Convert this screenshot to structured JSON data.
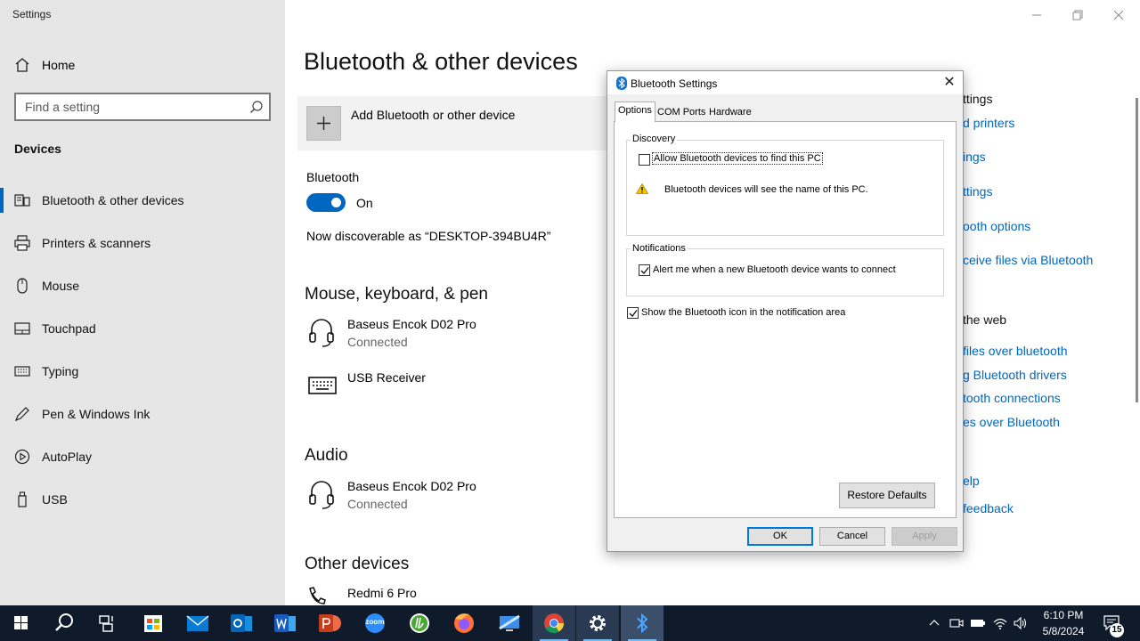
{
  "window": {
    "title": "Settings"
  },
  "sidebar": {
    "home_label": "Home",
    "search_placeholder": "Find a setting",
    "section_label": "Devices",
    "items": [
      {
        "label": "Bluetooth & other devices",
        "icon": "bluetooth-devices-icon",
        "selected": true
      },
      {
        "label": "Printers & scanners",
        "icon": "printer-icon"
      },
      {
        "label": "Mouse",
        "icon": "mouse-icon"
      },
      {
        "label": "Touchpad",
        "icon": "touchpad-icon"
      },
      {
        "label": "Typing",
        "icon": "keyboard-icon"
      },
      {
        "label": "Pen & Windows Ink",
        "icon": "pen-icon"
      },
      {
        "label": "AutoPlay",
        "icon": "autoplay-icon"
      },
      {
        "label": "USB",
        "icon": "usb-icon"
      }
    ]
  },
  "main": {
    "title": "Bluetooth & other devices",
    "add_device_label": "Add Bluetooth or other device",
    "bluetooth_label": "Bluetooth",
    "toggle_state": "On",
    "discoverable_text": "Now discoverable as “DESKTOP-394BU4R”",
    "sections": [
      {
        "heading": "Mouse, keyboard, & pen",
        "devices": [
          {
            "name": "Baseus Encok D02 Pro",
            "status": "Connected",
            "icon": "headset-icon"
          },
          {
            "name": "USB Receiver",
            "status": "",
            "icon": "keyboard-icon"
          }
        ]
      },
      {
        "heading": "Audio",
        "devices": [
          {
            "name": "Baseus Encok D02 Pro",
            "status": "Connected",
            "icon": "headset-icon"
          }
        ]
      },
      {
        "heading": "Other devices",
        "devices": [
          {
            "name": "Redmi 6 Pro",
            "status": "",
            "icon": "phone-icon"
          }
        ]
      }
    ]
  },
  "related": {
    "items": [
      {
        "text": "ttings",
        "type": "heading"
      },
      {
        "text": "d printers",
        "type": "link"
      },
      {
        "text": "ings",
        "type": "link"
      },
      {
        "text": "ttings",
        "type": "link"
      },
      {
        "text": "ooth options",
        "type": "link"
      },
      {
        "text": "ceive files via Bluetooth",
        "type": "link"
      },
      {
        "text": "the web",
        "type": "heading"
      },
      {
        "text": "files over bluetooth",
        "type": "link"
      },
      {
        "text": "g Bluetooth drivers",
        "type": "link"
      },
      {
        "text": "tooth connections",
        "type": "link"
      },
      {
        "text": "es over Bluetooth",
        "type": "link"
      },
      {
        "text": "elp",
        "type": "link"
      },
      {
        "text": "feedback",
        "type": "link"
      }
    ]
  },
  "dialog": {
    "title": "Bluetooth Settings",
    "tabs": [
      "Options",
      "COM Ports",
      "Hardware"
    ],
    "discovery": {
      "title": "Discovery",
      "allow_label": "Allow Bluetooth devices to find this PC",
      "allow_checked": false,
      "warning_text": "Bluetooth devices will see the name of this PC."
    },
    "notifications": {
      "title": "Notifications",
      "alert_label": "Alert me when a new Bluetooth device wants to connect",
      "alert_checked": true
    },
    "show_icon_label": "Show the Bluetooth icon in the notification area",
    "show_icon_checked": true,
    "restore_label": "Restore Defaults",
    "ok_label": "OK",
    "cancel_label": "Cancel",
    "apply_label": "Apply"
  },
  "taskbar": {
    "apps": [
      "start-icon",
      "search-icon",
      "task-view-icon",
      "store-icon",
      "mail-icon",
      "outlook-icon",
      "word-icon",
      "powerpoint-icon",
      "zoom-icon",
      "utorrent-icon",
      "firefox-icon",
      "remote-desktop-icon",
      "chrome-icon",
      "settings-icon",
      "bluetooth-icon"
    ],
    "zoom_label": "zoom",
    "time": "6:10 PM",
    "date": "5/8/2024",
    "notification_count": "15"
  },
  "colors": {
    "accent": "#0067c0",
    "taskbar": "#0f1a2a",
    "sidebar": "#e6e6e6"
  }
}
